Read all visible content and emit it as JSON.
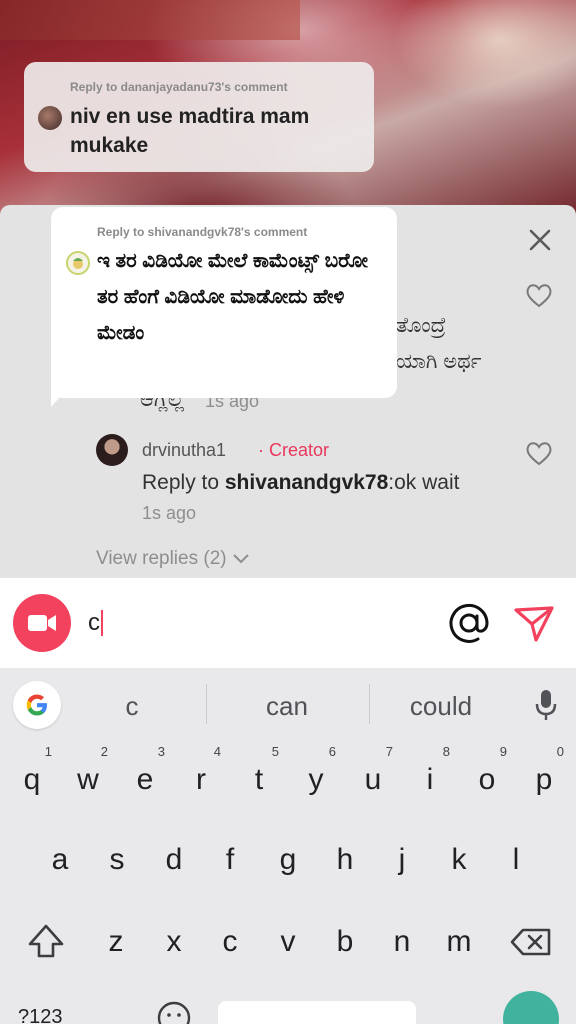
{
  "video_overlay": {
    "reply_context": "Reply to dananjayadanu73's comment",
    "reply_message": "niv en use madtira mam mukake"
  },
  "sticker": {
    "reply_context": "Reply to shivanandgvk78's comment",
    "reply_message": "ಇ ತರ ವಿಡಿಯೋ ಮೇಲೆ ಕಾಮೆಂಟ್ಸ್ ಬರೋ ತರ ಹೆಂಗೆ ವಿಡಿಯೋ ಮಾಡೋದು ಹೇಳಿ ಮೇಡಂ"
  },
  "comments": {
    "partial": {
      "line1": "ತೊಂದ್ರೆ",
      "line2": "ಯಾಗಿ ಅರ್ಥ",
      "line3": "ಆಗ್ಲಿಲ್ಲ",
      "time": "1s ago"
    },
    "creator_comment": {
      "username": "drvinutha1",
      "badge": "· Creator",
      "reply_prefix": "Reply to ",
      "reply_target": "shivanandgvk78",
      "text": ":ok wait",
      "time": "1s ago"
    },
    "view_replies": "View replies (2)"
  },
  "input": {
    "value": "c"
  },
  "keyboard": {
    "suggestions": [
      "c",
      "can",
      "could"
    ],
    "row1": [
      {
        "key": "q",
        "hint": "1"
      },
      {
        "key": "w",
        "hint": "2"
      },
      {
        "key": "e",
        "hint": "3"
      },
      {
        "key": "r",
        "hint": "4"
      },
      {
        "key": "t",
        "hint": "5"
      },
      {
        "key": "y",
        "hint": "6"
      },
      {
        "key": "u",
        "hint": "7"
      },
      {
        "key": "i",
        "hint": "8"
      },
      {
        "key": "o",
        "hint": "9"
      },
      {
        "key": "p",
        "hint": "0"
      }
    ],
    "row2": [
      "a",
      "s",
      "d",
      "f",
      "g",
      "h",
      "j",
      "k",
      "l"
    ],
    "row3": [
      "z",
      "x",
      "c",
      "v",
      "b",
      "n",
      "m"
    ],
    "numbers_label": "?123"
  },
  "colors": {
    "accent": "#f2425e",
    "creator": "#e8385c",
    "enter_key": "#40b29e",
    "sheet": "#e4e3e3"
  }
}
